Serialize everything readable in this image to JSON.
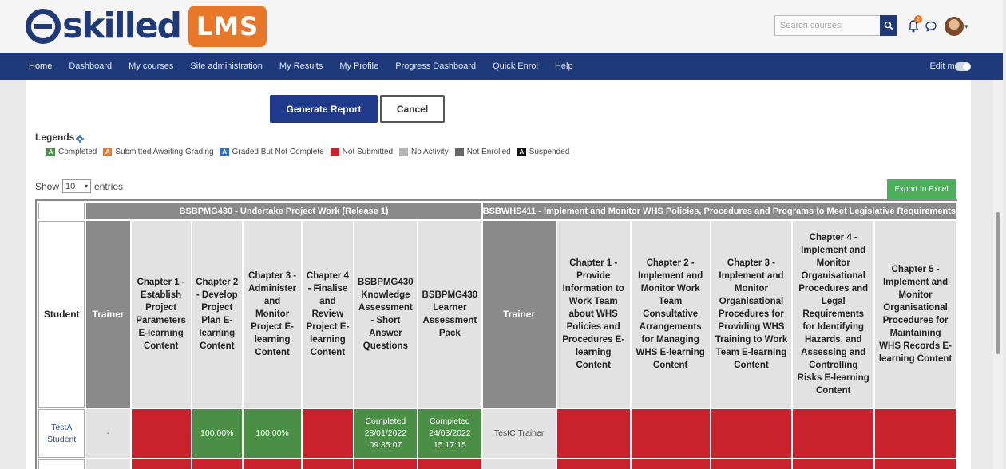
{
  "brand": {
    "logo_text": "skilled",
    "logo_badge": "LMS"
  },
  "header": {
    "search_placeholder": "Search courses",
    "notification_count": "2"
  },
  "nav": {
    "items": [
      "Home",
      "Dashboard",
      "My courses",
      "Site administration",
      "My Results",
      "My Profile",
      "Progress Dashboard",
      "Quick Enrol",
      "Help"
    ],
    "edit_mode_label": "Edit mode"
  },
  "actions": {
    "generate": "Generate Report",
    "cancel": "Cancel",
    "export": "Export to Excel"
  },
  "legends": {
    "title": "Legends",
    "items": [
      {
        "letter": "A",
        "label": "Completed",
        "color": "#4a8f45"
      },
      {
        "letter": "A",
        "label": "Submitted Awaiting Grading",
        "color": "#e8772a"
      },
      {
        "letter": "A",
        "label": "Graded But Not Complete",
        "color": "#2f6fc2"
      },
      {
        "letter": "",
        "label": "Not Submitted",
        "color": "#c8232c"
      },
      {
        "letter": "",
        "label": "No Activity",
        "color": "#b5b5b5"
      },
      {
        "letter": "",
        "label": "Not Enrolled",
        "color": "#666666"
      },
      {
        "letter": "A",
        "label": "Suspended",
        "color": "#111111"
      }
    ]
  },
  "entries": {
    "show": "Show",
    "value": "10",
    "suffix": "entries"
  },
  "table": {
    "courses": [
      "BSBPMG430 - Undertake Project Work (Release 1)",
      "BSBWHS411 - Implement and Monitor WHS Policies, Procedures and Programs to Meet Legislative Requirements"
    ],
    "student_header": "Student",
    "trainer_header": "Trainer",
    "course1_cols": [
      "Chapter 1 - Establish Project Parameters E-learning Content",
      "Chapter 2 - Develop Project Plan E-learning Content",
      "Chapter 3 - Administer and Monitor Project E-learning Content",
      "Chapter 4 - Finalise and Review Project E-learning Content",
      "BSBPMG430 Knowledge Assessment - Short Answer Questions",
      "BSBPMG430 Learner Assessment Pack"
    ],
    "course2_cols": [
      "Chapter 1 - Provide Information to Work Team about WHS Policies and Procedures E-learning Content",
      "Chapter 2 - Implement and Monitor Work Team Consultative Arrangements for Managing WHS E-learning Content",
      "Chapter 3 - Implement and Monitor Organisational Procedures for Providing WHS Training to Work Team E-learning Content",
      "Chapter 4 - Implement and Monitor Organisational Procedures and Legal Requirements for Identifying Hazards, and Assessing and Controlling Risks E-learning Content",
      "Chapter 5 - Implement and Monitor Organisational Procedures for Maintaining WHS Records E-learning Content"
    ],
    "rows": [
      {
        "student": "TestA Student",
        "trainer1": "-",
        "c1": [
          "",
          "100.00%",
          "100.00%",
          "",
          "Completed\n28/01/2022\n09:35:07",
          "Completed\n24/03/2022\n15:17:15"
        ],
        "trainer2": "TestC Trainer",
        "c2": [
          "",
          "",
          "",
          "",
          ""
        ]
      }
    ]
  }
}
